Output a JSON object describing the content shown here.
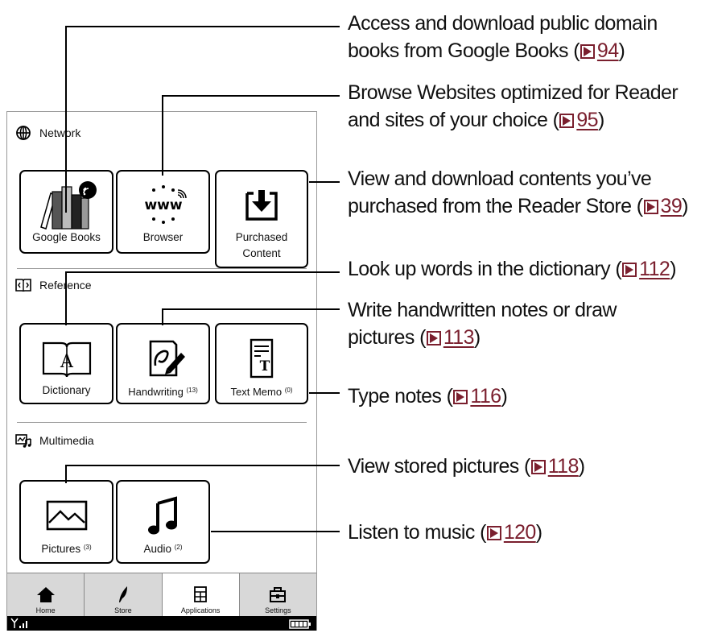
{
  "sections": {
    "network": "Network",
    "reference": "Reference",
    "multimedia": "Multimedia"
  },
  "apps": {
    "google_books": {
      "label": "Google Books"
    },
    "browser": {
      "label": "Browser"
    },
    "purchased": {
      "label_line1": "Purchased",
      "label_line2": "Content"
    },
    "dictionary": {
      "label": "Dictionary"
    },
    "handwriting": {
      "label": "Handwriting",
      "count": "(13)"
    },
    "text_memo": {
      "label": "Text Memo",
      "count": "(0)"
    },
    "pictures": {
      "label": "Pictures",
      "count": "(3)"
    },
    "audio": {
      "label": "Audio",
      "count": "(2)"
    }
  },
  "tabs": {
    "home": "Home",
    "store": "Store",
    "applications": "Applications",
    "settings": "Settings"
  },
  "callouts": {
    "google_books": {
      "line1": "Access and download public domain",
      "line2_pre": "books from Google Books (",
      "page": "94",
      "post": ")"
    },
    "browser": {
      "line1": "Browse Websites optimized for Reader",
      "line2_pre": "and sites of your choice (",
      "page": "95",
      "post": ")"
    },
    "purchased": {
      "line1": "View and download contents you’ve",
      "line2_pre": "purchased from the Reader Store (",
      "page": "39",
      "post": ")"
    },
    "dictionary": {
      "line1_pre": "Look up words in the dictionary (",
      "page": "112",
      "post": ")"
    },
    "handwriting": {
      "line1": "Write handwritten notes or draw",
      "line2_pre": "pictures (",
      "page": "113",
      "post": ")"
    },
    "text_memo": {
      "line1_pre": "Type notes (",
      "page": "116",
      "post": ")"
    },
    "pictures": {
      "line1_pre": "View stored pictures (",
      "page": "118",
      "post": ")"
    },
    "audio": {
      "line1_pre": "Listen to music (",
      "page": "120",
      "post": ")"
    }
  },
  "colors": {
    "page_ref": "#7a1f2e",
    "tab_inactive": "#d8d8d8",
    "status_bar": "#000000"
  }
}
